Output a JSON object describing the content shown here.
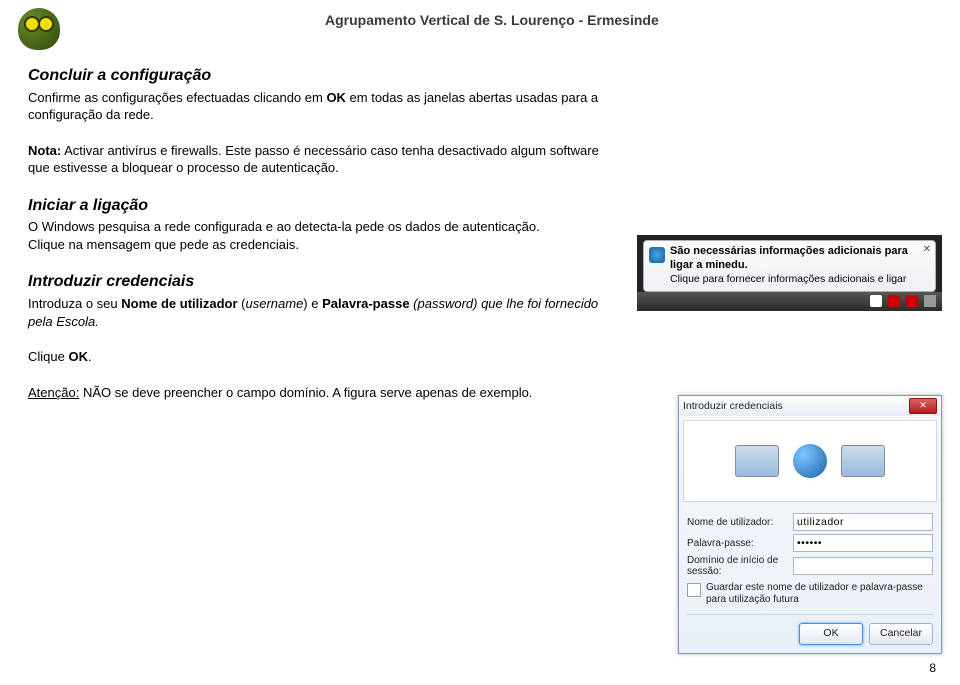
{
  "header": "Agrupamento Vertical de S. Lourenço - Ermesinde",
  "page_number": "8",
  "sections": {
    "concluir": {
      "title": "Concluir a configuração",
      "body_a": "Confirme as configurações efectuadas clicando em ",
      "ok_bold": "OK",
      "body_b": " em todas as janelas abertas usadas para a configuração da rede."
    },
    "nota": {
      "note_bold": "Nota:",
      "note_text": " Activar antivírus e firewalls. Este passo é necessário caso tenha desactivado algum software que estivesse a bloquear o processo de autenticação."
    },
    "iniciar": {
      "title": "Iniciar a ligação",
      "body": "O Windows pesquisa a rede configurada e ao detecta-la pede os dados de autenticação.\nClique na mensagem que pede as credenciais."
    },
    "intro": {
      "title": "Introduzir credenciais",
      "body_a": "Introduza o seu ",
      "user_bold": "Nome de utilizador",
      "user_par": " (",
      "user_it": "username",
      "user_close": ") e ",
      "pass_bold": "Palavra-passe",
      "pass_it_open": " (",
      "pass_it": "password",
      "pass_rest": ") que lhe foi fornecido pela Escola."
    },
    "clique_ok": {
      "body_a": "Clique ",
      "ok_bold": "OK",
      "body_b": "."
    },
    "atencao": {
      "attn_bold": "Atenção:",
      "body": " NÃO se deve preencher o campo domínio. A figura serve apenas de exemplo."
    }
  },
  "balloon": {
    "title": "São necessárias informações adicionais para ligar a minedu.",
    "sub": "Clique para fornecer informações adicionais e ligar"
  },
  "dialog": {
    "title": "Introduzir credenciais",
    "labels": {
      "user": "Nome de utilizador:",
      "pass": "Palavra-passe:",
      "domain": "Domínio de início de sessão:"
    },
    "values": {
      "user": "utilizador",
      "pass": "••••••"
    },
    "checkbox_label": "Guardar este nome de utilizador e palavra-passe para utilização futura",
    "buttons": {
      "ok": "OK",
      "cancel": "Cancelar"
    }
  }
}
